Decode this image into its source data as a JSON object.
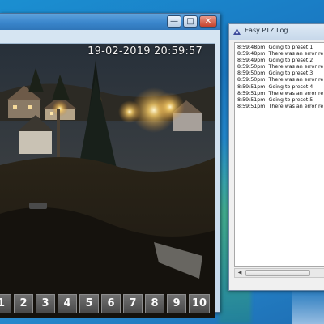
{
  "camera_window": {
    "title": "",
    "controls": {
      "minimize": "—",
      "maximize": "□",
      "close": "✕"
    },
    "timestamp": "19-02-2019 20:59:57",
    "presets": [
      "1",
      "2",
      "3",
      "4",
      "5",
      "6",
      "7",
      "8",
      "9",
      "10"
    ]
  },
  "log_window": {
    "title": "Easy PTZ Log",
    "icon": "ptz-app-icon",
    "entries": [
      "8:59:48pm: Going to preset 1",
      "8:59:48pm: There was an error re",
      "8:59:49pm: Going to preset 2",
      "8:59:50pm: There was an error re",
      "8:59:50pm: Going to preset 3",
      "8:59:50pm: There was an error re",
      "8:59:51pm: Going to preset 4",
      "8:59:51pm: There was an error re",
      "8:59:51pm: Going to preset 5",
      "8:59:51pm: There was an error re"
    ]
  },
  "colors": {
    "desktop": "#1a78c2",
    "titlebar_active": "#3a86cc",
    "preset_button": "#5a5a5a",
    "close_button": "#c6412b"
  }
}
